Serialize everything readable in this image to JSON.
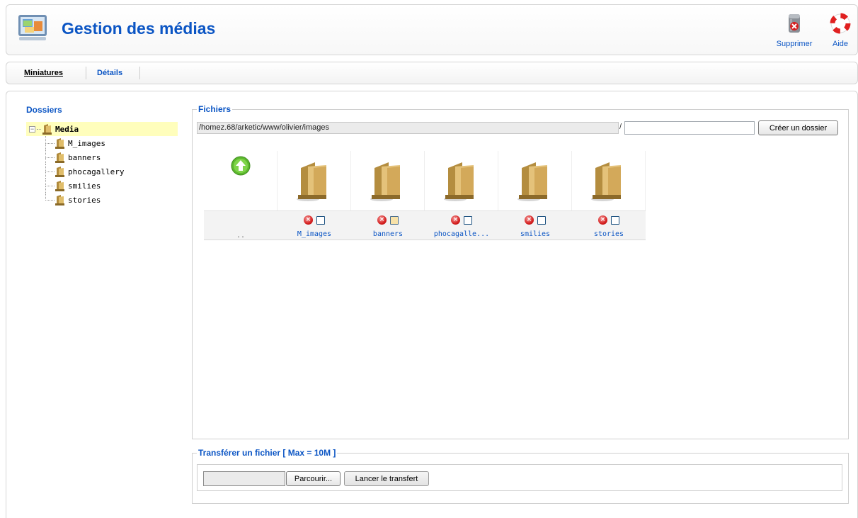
{
  "header": {
    "title": "Gestion des médias",
    "icon": "media-manager-icon",
    "toolbar": [
      {
        "label": "Supprimer",
        "icon": "trash-delete-icon"
      },
      {
        "label": "Aide",
        "icon": "lifebuoy-help-icon"
      }
    ]
  },
  "submenu": {
    "items": [
      {
        "label": "Miniatures",
        "active": true
      },
      {
        "label": "Détails",
        "active": false
      }
    ]
  },
  "folders": {
    "title": "Dossiers",
    "root": "Media",
    "children": [
      "M_images",
      "banners",
      "phocagallery",
      "smilies",
      "stories"
    ]
  },
  "files": {
    "legend": "Fichiers",
    "path": "/homez.68/arketic/www/olivier/images",
    "path_separator": "/",
    "new_folder_value": "",
    "create_button": "Créer un dossier",
    "up_label": "..",
    "items": [
      {
        "name": "M_images",
        "checked": false
      },
      {
        "name": "banners",
        "checked": true
      },
      {
        "name": "phocagalle...",
        "checked": false
      },
      {
        "name": "smilies",
        "checked": false
      },
      {
        "name": "stories",
        "checked": false
      }
    ]
  },
  "upload": {
    "legend": "Transférer un fichier [ Max = 10M ]",
    "browse_button": "Parcourir...",
    "upload_button": "Lancer le transfert"
  },
  "colors": {
    "accent": "#0b55c4",
    "tree_highlight": "#fffebc"
  }
}
